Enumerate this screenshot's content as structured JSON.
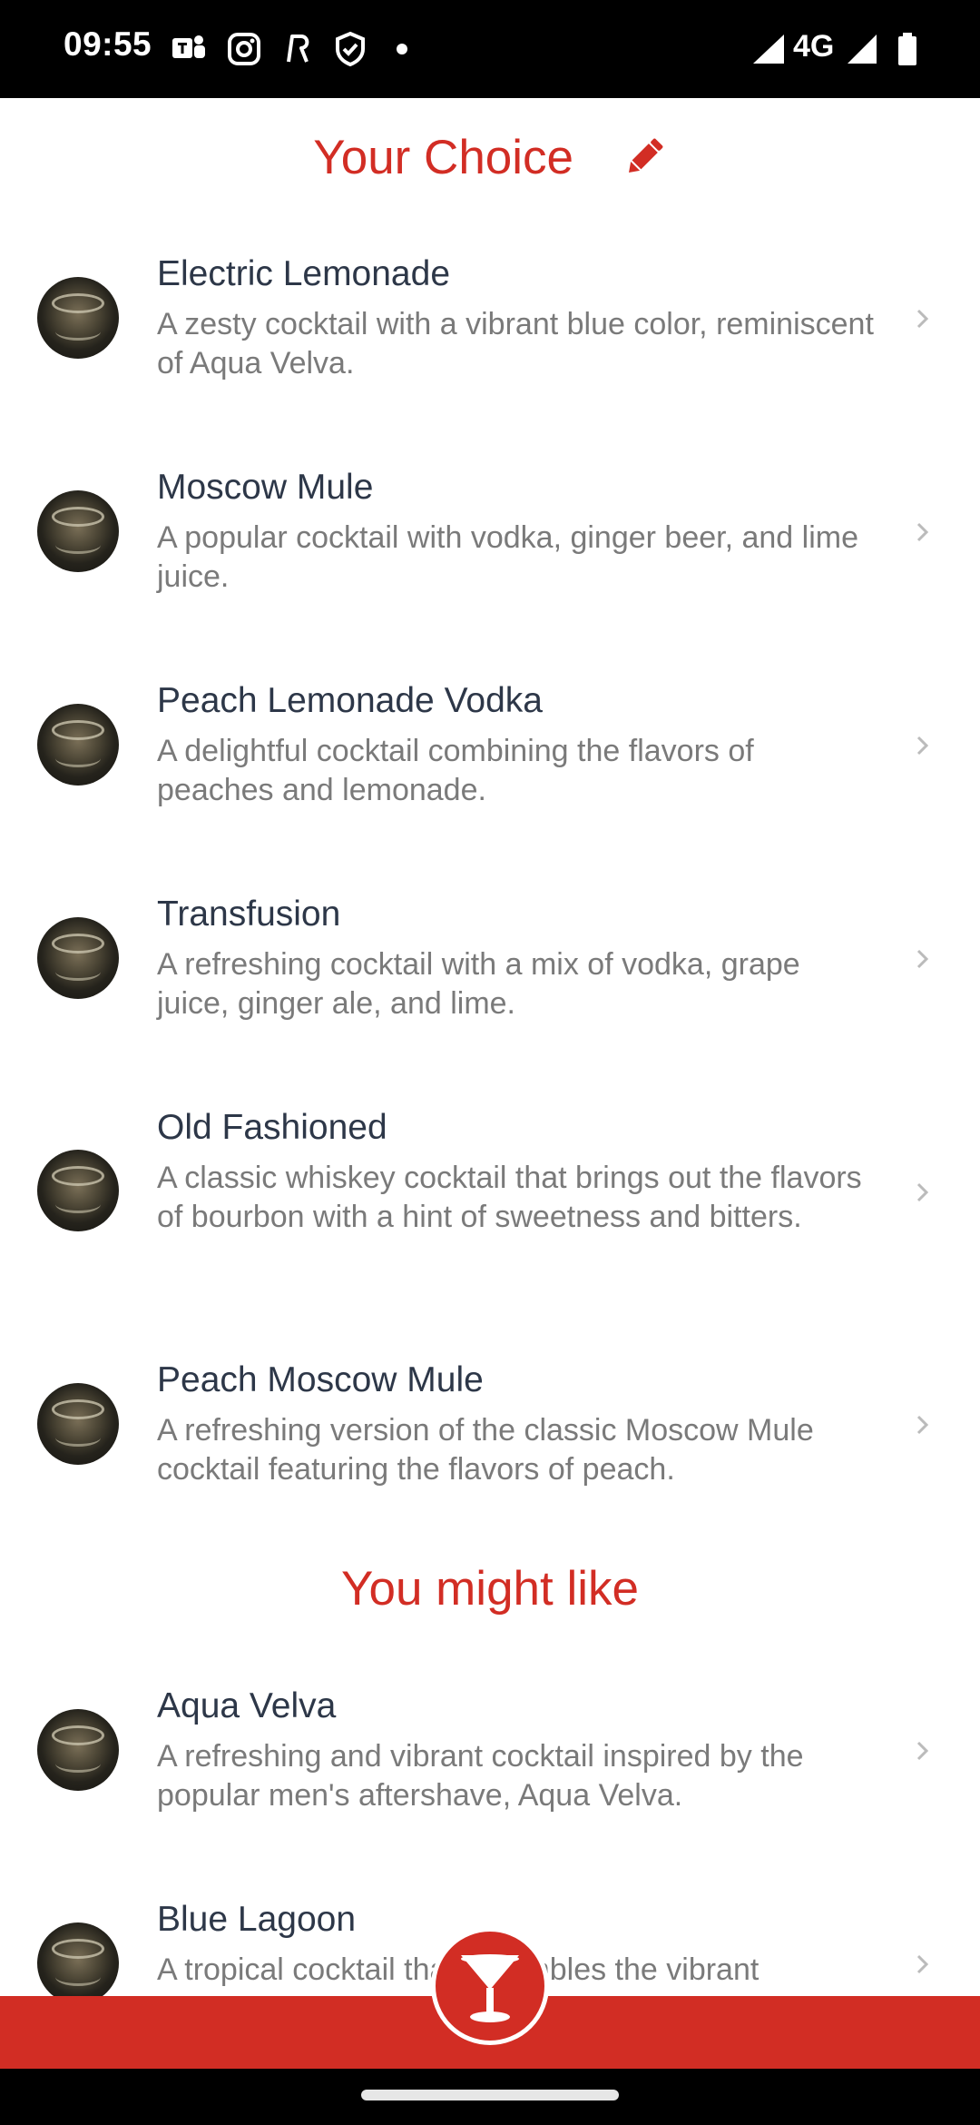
{
  "status_bar": {
    "time": "09:55",
    "icons": [
      "teams-icon",
      "instagram-icon",
      "r-app-icon",
      "shield-check-icon",
      "notification-dot",
      "signal-icon",
      "signal-icon",
      "battery-icon"
    ],
    "network": "4G"
  },
  "your_choice": {
    "title": "Your Choice",
    "edit_icon": "pencil-icon",
    "items": [
      {
        "name": "Electric Lemonade",
        "description": "A zesty cocktail with a vibrant blue color, reminiscent of Aqua Velva."
      },
      {
        "name": "Moscow Mule",
        "description": "A popular cocktail with vodka, ginger beer, and lime juice."
      },
      {
        "name": "Peach Lemonade Vodka",
        "description": "A delightful cocktail combining the flavors of peaches and lemonade."
      },
      {
        "name": "Transfusion",
        "description": "A refreshing cocktail with a mix of vodka, grape juice, ginger ale, and lime."
      },
      {
        "name": "Old Fashioned",
        "description": "A classic whiskey cocktail that brings out the flavors of bourbon with a hint of sweetness and bitters."
      },
      {
        "name": "Peach Moscow Mule",
        "description": "A refreshing version of the classic Moscow Mule cocktail featuring the flavors of peach."
      }
    ]
  },
  "you_might_like": {
    "title": "You might like",
    "items": [
      {
        "name": "Aqua Velva",
        "description": "A refreshing and vibrant cocktail inspired by the popular men's aftershave, Aqua Velva."
      },
      {
        "name": "Blue Lagoon",
        "description": "A tropical cocktail that resembles the vibrant"
      }
    ]
  },
  "bottom_bar": {
    "fab_icon": "cocktail-glass-icon"
  },
  "colors": {
    "accent": "#d22d24",
    "title_text": "#2d3748",
    "description_text": "#7a7a7a"
  }
}
